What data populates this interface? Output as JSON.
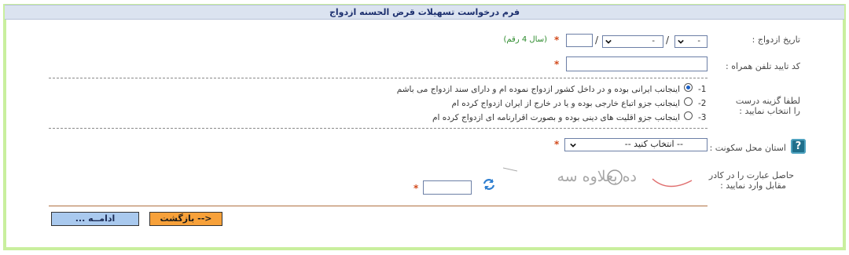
{
  "form": {
    "title": "فرم درخواست تسهیلات قرض الحسنه ازدواج",
    "marriage_date": {
      "label": "تاریخ ازدواج :",
      "day_value": "-",
      "month_value": "-",
      "separator": "/",
      "year_value": "",
      "year_hint": "(سال 4 رقم)",
      "required_mark": "*"
    },
    "mobile": {
      "label": "کد تایید تلفن همراه :",
      "value": "",
      "required_mark": "*"
    },
    "options": {
      "label_line1": "لطفا گزینه درست",
      "label_line2": "را انتخاب نمایید :",
      "items": [
        {
          "num": "-1",
          "text": "اینجانب ایرانی بوده و در داخل کشور ازدواج نموده ام و دارای سند ازدواج می باشم",
          "selected": true
        },
        {
          "num": "-2",
          "text": "اینجانب جزو اتباع خارجی بوده و یا در خارج از ایران ازدواج کرده ام",
          "selected": false
        },
        {
          "num": "-3",
          "text": "اینجانب جزو اقلیت های دینی بوده و بصورت اقرارنامه ای ازدواج کرده ام",
          "selected": false
        }
      ]
    },
    "province": {
      "label": "استان محل سکونت :",
      "selected": "-- انتخاب کنید --",
      "required_mark": "*",
      "help_icon_glyph": "?"
    },
    "captcha": {
      "label_line1": "حاصل عبارت را در کادر",
      "label_line2": "مقابل وارد نمایید :",
      "image_text": "ده بعلاوه سه",
      "value": "",
      "required_mark": "*"
    },
    "buttons": {
      "back": "<-- بازگشت",
      "continue": "ادامــه ..."
    }
  },
  "colors": {
    "frame_border": "#c9ef9e",
    "title_bg": "#dbe3f0",
    "back_button": "#f7a13a",
    "continue_button": "#a9c9ee",
    "required": "#d24a1c",
    "hint": "#2b8a2b"
  }
}
